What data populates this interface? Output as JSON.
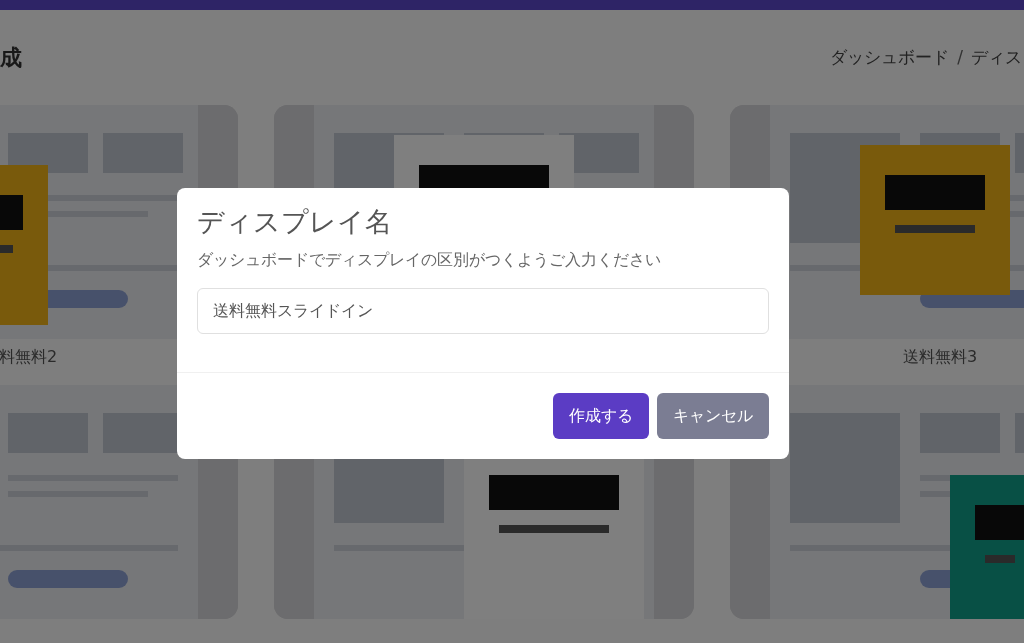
{
  "page": {
    "title": "成",
    "breadcrumb": {
      "items": [
        "ダッシュボード",
        "ディス"
      ],
      "separator": "/"
    }
  },
  "templates": [
    {
      "kind": "picture",
      "label": "料無料2"
    },
    {
      "kind": "picture"
    },
    {
      "kind": "picture",
      "label": "送料無料3"
    },
    {
      "kind": "picture"
    },
    {
      "kind": "picture"
    },
    {
      "kind": "picture"
    }
  ],
  "dialog": {
    "title": "ディスプレイ名",
    "description": "ダッシュボードでディスプレイの区別がつくようご入力ください",
    "name_field": {
      "value": "送料無料スライドイン"
    },
    "buttons": [
      {
        "label": "作成する",
        "kind": "primary"
      },
      {
        "label": "キャンセル",
        "kind": "secondary"
      }
    ]
  }
}
